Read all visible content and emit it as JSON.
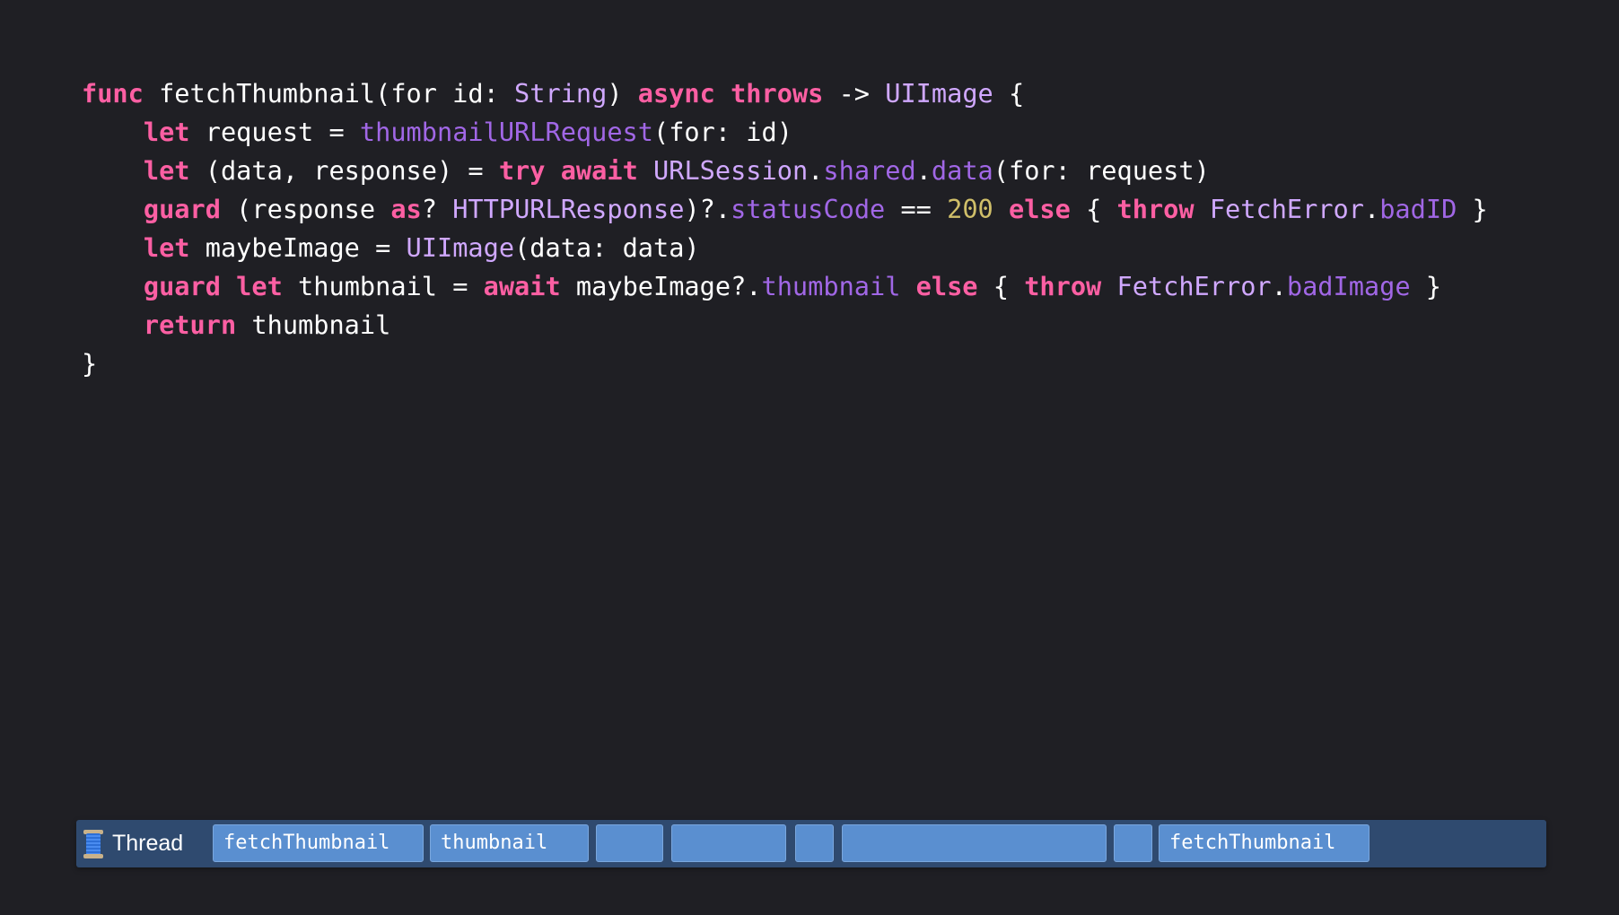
{
  "code": {
    "lines": [
      [
        {
          "t": "func",
          "c": "kw"
        },
        {
          "t": " fetchThumbnail(for id: ",
          "c": "pl"
        },
        {
          "t": "String",
          "c": "ty"
        },
        {
          "t": ") ",
          "c": "pl"
        },
        {
          "t": "async",
          "c": "kw"
        },
        {
          "t": " ",
          "c": "pl"
        },
        {
          "t": "throws",
          "c": "kw"
        },
        {
          "t": " -> ",
          "c": "pl"
        },
        {
          "t": "UIImage",
          "c": "ty"
        },
        {
          "t": " {",
          "c": "pl"
        }
      ],
      [
        {
          "t": "    ",
          "c": "pl"
        },
        {
          "t": "let",
          "c": "kw"
        },
        {
          "t": " request = ",
          "c": "pl"
        },
        {
          "t": "thumbnailURLRequest",
          "c": "fn"
        },
        {
          "t": "(for: id)",
          "c": "pl"
        }
      ],
      [
        {
          "t": "    ",
          "c": "pl"
        },
        {
          "t": "let",
          "c": "kw"
        },
        {
          "t": " (data, response) = ",
          "c": "pl"
        },
        {
          "t": "try",
          "c": "kw"
        },
        {
          "t": " ",
          "c": "pl"
        },
        {
          "t": "await",
          "c": "kw"
        },
        {
          "t": " ",
          "c": "pl"
        },
        {
          "t": "URLSession",
          "c": "ty"
        },
        {
          "t": ".",
          "c": "pl"
        },
        {
          "t": "shared",
          "c": "fn"
        },
        {
          "t": ".",
          "c": "pl"
        },
        {
          "t": "data",
          "c": "fn"
        },
        {
          "t": "(for: request)",
          "c": "pl"
        }
      ],
      [
        {
          "t": "    ",
          "c": "pl"
        },
        {
          "t": "guard",
          "c": "kw"
        },
        {
          "t": " (response ",
          "c": "pl"
        },
        {
          "t": "as",
          "c": "kw"
        },
        {
          "t": "? ",
          "c": "pl"
        },
        {
          "t": "HTTPURLResponse",
          "c": "ty"
        },
        {
          "t": ")?.",
          "c": "pl"
        },
        {
          "t": "statusCode",
          "c": "fn"
        },
        {
          "t": " == ",
          "c": "pl"
        },
        {
          "t": "200",
          "c": "num"
        },
        {
          "t": " ",
          "c": "pl"
        },
        {
          "t": "else",
          "c": "kw"
        },
        {
          "t": " { ",
          "c": "pl"
        },
        {
          "t": "throw",
          "c": "kw"
        },
        {
          "t": " ",
          "c": "pl"
        },
        {
          "t": "FetchError",
          "c": "ty"
        },
        {
          "t": ".",
          "c": "pl"
        },
        {
          "t": "badID",
          "c": "fn"
        },
        {
          "t": " }",
          "c": "pl"
        }
      ],
      [
        {
          "t": "    ",
          "c": "pl"
        },
        {
          "t": "let",
          "c": "kw"
        },
        {
          "t": " maybeImage = ",
          "c": "pl"
        },
        {
          "t": "UIImage",
          "c": "ty"
        },
        {
          "t": "(data: data)",
          "c": "pl"
        }
      ],
      [
        {
          "t": "    ",
          "c": "pl"
        },
        {
          "t": "guard",
          "c": "kw"
        },
        {
          "t": " ",
          "c": "pl"
        },
        {
          "t": "let",
          "c": "kw"
        },
        {
          "t": " thumbnail = ",
          "c": "pl"
        },
        {
          "t": "await",
          "c": "kw"
        },
        {
          "t": " maybeImage?.",
          "c": "pl"
        },
        {
          "t": "thumbnail",
          "c": "fn"
        },
        {
          "t": " ",
          "c": "pl"
        },
        {
          "t": "else",
          "c": "kw"
        },
        {
          "t": " { ",
          "c": "pl"
        },
        {
          "t": "throw",
          "c": "kw"
        },
        {
          "t": " ",
          "c": "pl"
        },
        {
          "t": "FetchError",
          "c": "ty"
        },
        {
          "t": ".",
          "c": "pl"
        },
        {
          "t": "badImage",
          "c": "fn"
        },
        {
          "t": " }",
          "c": "pl"
        }
      ],
      [
        {
          "t": "    ",
          "c": "pl"
        },
        {
          "t": "return",
          "c": "kw"
        },
        {
          "t": " thumbnail",
          "c": "pl"
        }
      ],
      [
        {
          "t": "}",
          "c": "pl"
        }
      ]
    ]
  },
  "colors": {
    "background": "#1f1f24",
    "keyword": "#fc5fa3",
    "type": "#d0a8ff",
    "member": "#a167e6",
    "number": "#d0bf69",
    "plain": "#ffffff",
    "timeline_bg": "#2f4a6f",
    "segment": "#5a8fd0"
  },
  "timeline": {
    "icon": "spool-of-thread-icon",
    "label": "Thread",
    "segments": [
      {
        "label": "fetchThumbnail"
      },
      {
        "label": "thumbnail"
      },
      {
        "label": ""
      },
      {
        "label": ""
      },
      {
        "label": ""
      },
      {
        "label": ""
      },
      {
        "label": ""
      },
      {
        "label": "fetchThumbnail"
      }
    ]
  }
}
